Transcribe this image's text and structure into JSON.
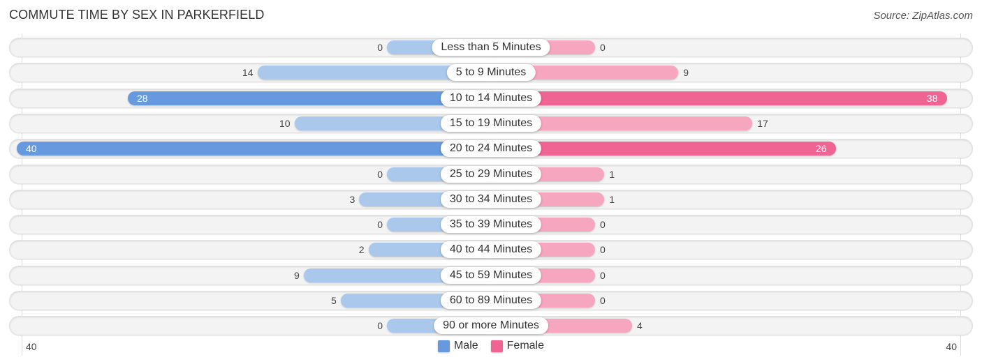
{
  "header": {
    "title": "COMMUTE TIME BY SEX IN PARKERFIELD",
    "source": "Source: ZipAtlas.com"
  },
  "colors": {
    "male_strong": "#6699dd",
    "male_light": "#a9c8ec",
    "female_strong": "#f06493",
    "female_light": "#f7a6c0",
    "row_bg": "#f3f3f3"
  },
  "chart_data": {
    "type": "bar",
    "orientation": "horizontal-diverging",
    "title": "COMMUTE TIME BY SEX IN PARKERFIELD",
    "categories": [
      "Less than 5 Minutes",
      "5 to 9 Minutes",
      "10 to 14 Minutes",
      "15 to 19 Minutes",
      "20 to 24 Minutes",
      "25 to 29 Minutes",
      "30 to 34 Minutes",
      "35 to 39 Minutes",
      "40 to 44 Minutes",
      "45 to 59 Minutes",
      "60 to 89 Minutes",
      "90 or more Minutes"
    ],
    "series": [
      {
        "name": "Male",
        "values": [
          0,
          14,
          28,
          10,
          40,
          0,
          3,
          0,
          2,
          9,
          5,
          0
        ]
      },
      {
        "name": "Female",
        "values": [
          0,
          9,
          38,
          17,
          26,
          1,
          1,
          0,
          0,
          0,
          0,
          4
        ]
      }
    ],
    "axis": {
      "left_label": "40",
      "right_label": "40",
      "max": 40
    },
    "legend": {
      "position": "bottom-center",
      "items": [
        "Male",
        "Female"
      ]
    },
    "grid": false
  }
}
